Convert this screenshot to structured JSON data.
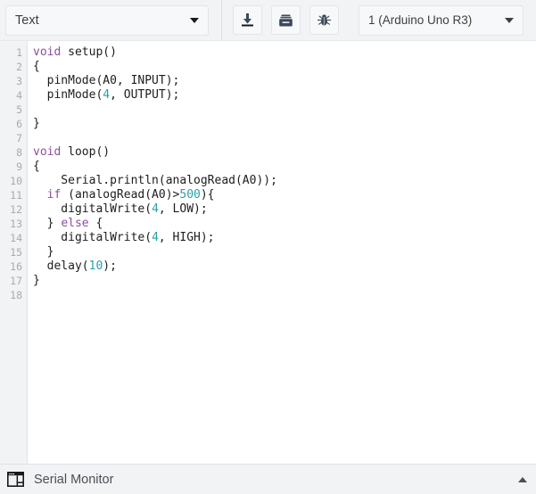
{
  "toolbar": {
    "type_select": {
      "value": "Text",
      "caret_icon": "chevron-down-icon"
    },
    "buttons": [
      {
        "name": "upload-button",
        "icon": "download-arrow-icon",
        "tooltip": "Upload"
      },
      {
        "name": "library-button",
        "icon": "archive-box-icon",
        "tooltip": "Library"
      },
      {
        "name": "debug-button",
        "icon": "bug-icon",
        "tooltip": "Debug"
      }
    ],
    "board_select": {
      "value": "1 (Arduino Uno R3)",
      "caret_icon": "chevron-down-icon"
    }
  },
  "editor": {
    "line_numbers": [
      "1",
      "2",
      "3",
      "4",
      "5",
      "6",
      "7",
      "8",
      "9",
      "10",
      "11",
      "12",
      "13",
      "14",
      "15",
      "16",
      "17",
      "18"
    ],
    "lines": [
      {
        "n": "1",
        "text": "void setup()"
      },
      {
        "n": "2",
        "text": "{"
      },
      {
        "n": "3",
        "text": "  pinMode(A0, INPUT);"
      },
      {
        "n": "4",
        "text": "  pinMode(4, OUTPUT);"
      },
      {
        "n": "5",
        "text": ""
      },
      {
        "n": "6",
        "text": "}"
      },
      {
        "n": "7",
        "text": ""
      },
      {
        "n": "8",
        "text": "void loop()"
      },
      {
        "n": "9",
        "text": "{"
      },
      {
        "n": "10",
        "text": "    Serial.println(analogRead(A0));"
      },
      {
        "n": "11",
        "text": "  if (analogRead(A0)>500){"
      },
      {
        "n": "12",
        "text": "    digitalWrite(4, LOW);"
      },
      {
        "n": "13",
        "text": "  } else {"
      },
      {
        "n": "14",
        "text": "    digitalWrite(4, HIGH);"
      },
      {
        "n": "15",
        "text": "  }"
      },
      {
        "n": "16",
        "text": "  delay(10);"
      },
      {
        "n": "17",
        "text": "}"
      },
      {
        "n": "18",
        "text": ""
      }
    ],
    "syntax_colors": {
      "keyword": "#8b4f9e",
      "number": "#2b9fa8",
      "plain": "#1d1d1f",
      "line_number": "#a8abaf"
    }
  },
  "statusbar": {
    "panel_icon": "window-panel-icon",
    "label": "Serial Monitor",
    "expand_icon": "chevron-up-icon"
  },
  "colors": {
    "chrome_bg": "#f2f3f5",
    "editor_bg": "#ffffff",
    "control_bg": "#f7f8fa",
    "border": "#e3e5e9",
    "icon": "#3b4a5a"
  }
}
